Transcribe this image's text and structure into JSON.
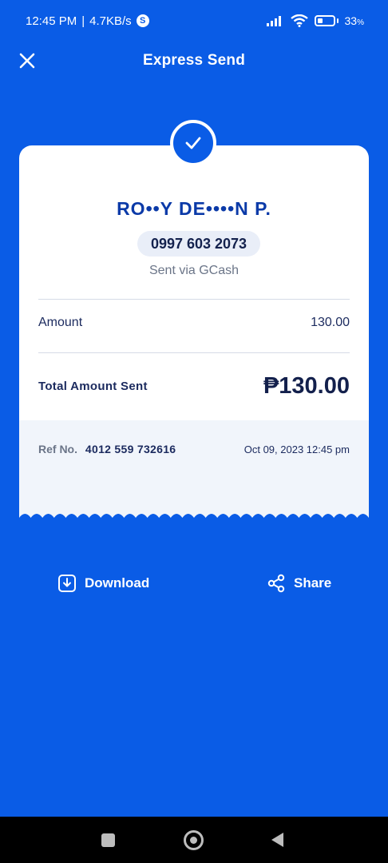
{
  "status_bar": {
    "time": "12:45 PM",
    "separator": "|",
    "speed": "4.7KB/s",
    "badge": "S",
    "battery_percent": "33",
    "battery_level": 0.33
  },
  "header": {
    "title": "Express Send"
  },
  "receipt": {
    "recipient_name": "RO••Y DE••••N P.",
    "phone": "0997 603 2073",
    "via": "Sent via GCash",
    "amount_label": "Amount",
    "amount_value": "130.00",
    "total_label": "Total Amount Sent",
    "total_value": "₱130.00",
    "ref_label": "Ref No.",
    "ref_number": "4012 559 732616",
    "date": "Oct 09, 2023 12:45 pm"
  },
  "actions": {
    "download_label": "Download",
    "share_label": "Share"
  },
  "colors": {
    "background": "#0a5ce6",
    "card": "#ffffff",
    "recipient_text": "#0b3aa8",
    "ref_area": "#f1f5fb"
  },
  "icons": {
    "close": "close-icon",
    "check": "check-icon",
    "download": "download-icon",
    "share": "share-icon"
  }
}
